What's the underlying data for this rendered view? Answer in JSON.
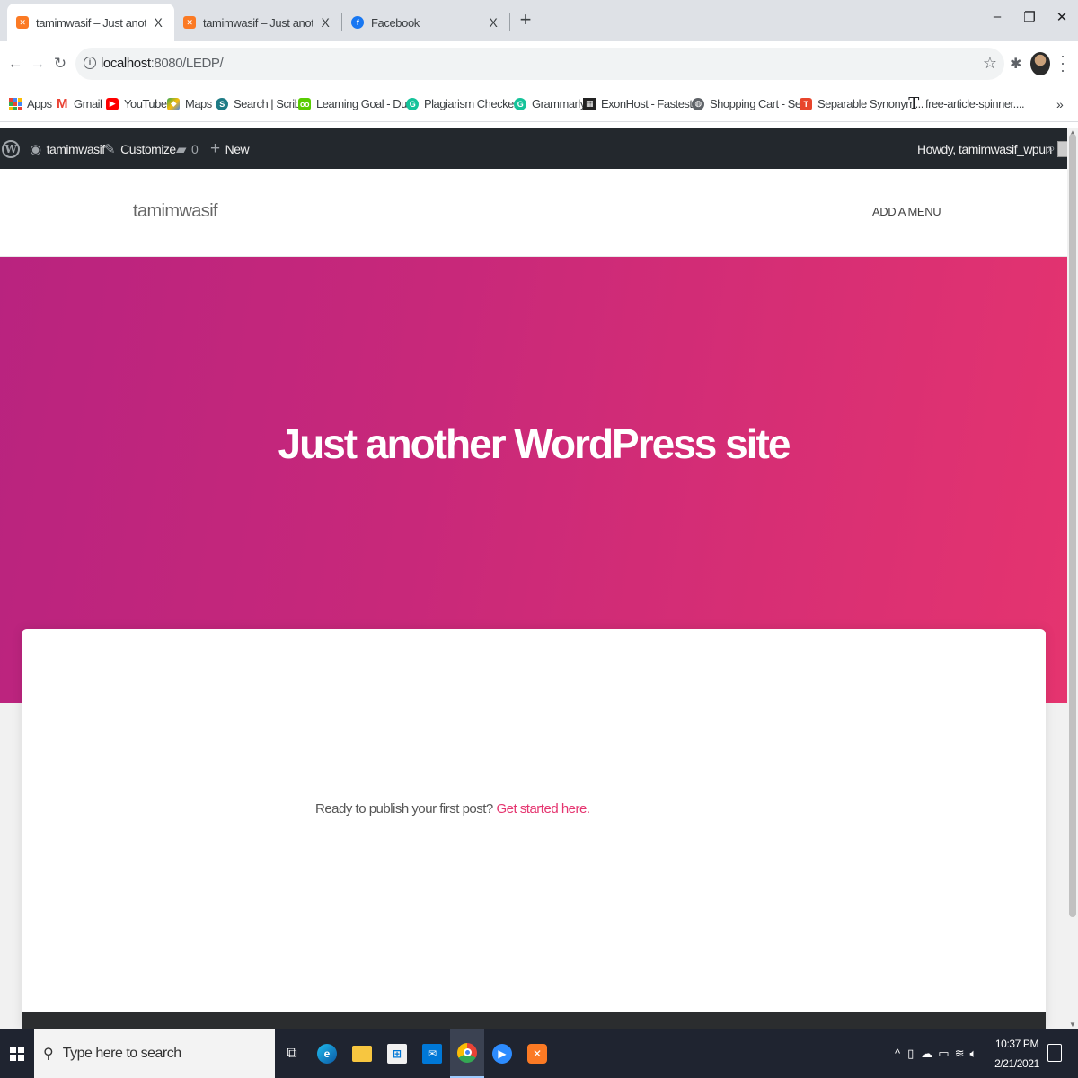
{
  "browser": {
    "tabs": [
      {
        "title": "tamimwasif – Just another WordPress site",
        "icon": "xampp-icon",
        "active": true
      },
      {
        "title": "tamimwasif – Just another WordPress site",
        "icon": "xampp-icon",
        "active": false
      },
      {
        "title": "Facebook",
        "icon": "facebook-icon",
        "active": false
      }
    ],
    "tab_close_glyph": "X",
    "new_tab_glyph": "+",
    "window_controls": {
      "minimize": "–",
      "maximize": "❐",
      "close": "✕"
    },
    "url_host": "localhost",
    "url_rest": ":8080/LEDP/",
    "bookmarks": [
      {
        "label": "Apps",
        "icon": "apps-grid-icon",
        "color": "#4285f4"
      },
      {
        "label": "Gmail",
        "icon": "gmail-icon",
        "color": "#ea4335"
      },
      {
        "label": "YouTube",
        "icon": "youtube-icon",
        "color": "#ff0000"
      },
      {
        "label": "Maps",
        "icon": "maps-icon",
        "color": "#34a853"
      },
      {
        "label": "Search | Scribd",
        "icon": "scribd-icon",
        "color": "#1e7b85"
      },
      {
        "label": "Learning Goal - Du...",
        "icon": "duolingo-icon",
        "color": "#58cc02"
      },
      {
        "label": "Plagiarism Checker...",
        "icon": "grammarly-icon",
        "color": "#15c39a"
      },
      {
        "label": "Grammarly",
        "icon": "grammarly-icon",
        "color": "#15c39a"
      },
      {
        "label": "ExonHost - Fastest...",
        "icon": "exonhost-icon",
        "color": "#222222"
      },
      {
        "label": "Shopping Cart - Ser...",
        "icon": "globe-icon",
        "color": "#5f6368"
      },
      {
        "label": "Separable Synonym...",
        "icon": "thesaurus-icon",
        "color": "#e8452c"
      },
      {
        "label": "free-article-spinner....",
        "icon": "t-letter-icon",
        "color": "#202124"
      }
    ],
    "bookmarks_more": "»"
  },
  "adminbar": {
    "site_name": "tamimwasif",
    "customize": "Customize",
    "comments_count": "0",
    "new_label": "New",
    "howdy": "Howdy, tamimwasif_wpun"
  },
  "site": {
    "title": "tamimwasif",
    "menu_label": "ADD A MENU",
    "hero_title": "Just another WordPress site",
    "post_prompt": "Ready to publish your first post? ",
    "post_link": "Get started here.",
    "accent_color": "#e5346f"
  },
  "taskbar": {
    "search_placeholder": "Type here to search",
    "apps": [
      {
        "name": "task-view-icon"
      },
      {
        "name": "edge-icon"
      },
      {
        "name": "file-explorer-icon"
      },
      {
        "name": "store-icon"
      },
      {
        "name": "mail-icon"
      },
      {
        "name": "chrome-icon",
        "active": true
      },
      {
        "name": "zoom-icon"
      },
      {
        "name": "xampp-icon"
      }
    ],
    "time": "10:37 PM",
    "date": "2/21/2021"
  }
}
